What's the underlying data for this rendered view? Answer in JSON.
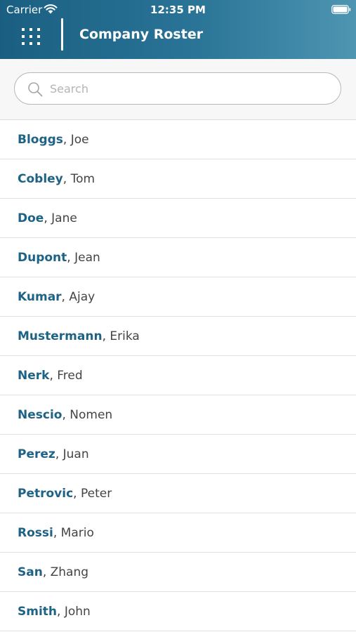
{
  "status_bar": {
    "carrier": "Carrier",
    "time": "12:35 PM"
  },
  "nav": {
    "title": "Company Roster"
  },
  "search": {
    "placeholder": "Search",
    "value": ""
  },
  "colors": {
    "header_gradient_start": "#1a5f82",
    "header_gradient_end": "#4e95b1",
    "last_name": "#1e6385",
    "first_name": "#444444"
  },
  "roster": [
    {
      "last": "Bloggs",
      "separator": ", ",
      "first": "Joe"
    },
    {
      "last": "Cobley",
      "separator": ", ",
      "first": "Tom"
    },
    {
      "last": "Doe",
      "separator": ", ",
      "first": "Jane"
    },
    {
      "last": "Dupont",
      "separator": ", ",
      "first": "Jean"
    },
    {
      "last": "Kumar",
      "separator": ", ",
      "first": "Ajay"
    },
    {
      "last": "Mustermann",
      "separator": ", ",
      "first": "Erika"
    },
    {
      "last": "Nerk",
      "separator": ", ",
      "first": "Fred"
    },
    {
      "last": "Nescio",
      "separator": ", ",
      "first": "Nomen"
    },
    {
      "last": "Perez",
      "separator": ", ",
      "first": "Juan"
    },
    {
      "last": "Petrovic",
      "separator": ", ",
      "first": "Peter"
    },
    {
      "last": "Rossi",
      "separator": ", ",
      "first": "Mario"
    },
    {
      "last": "San",
      "separator": ", ",
      "first": "Zhang"
    },
    {
      "last": "Smith",
      "separator": ", ",
      "first": "John"
    }
  ]
}
